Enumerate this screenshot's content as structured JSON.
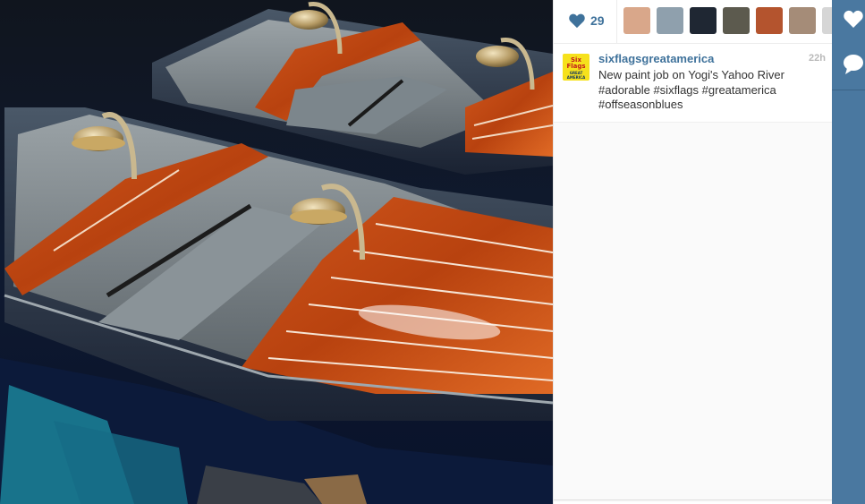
{
  "post": {
    "likes_count": "29",
    "author": {
      "username": "sixflagsgreatamerica",
      "avatar_lines": [
        "Six",
        "Flags"
      ],
      "avatar_sub": "GREAT AMERICA"
    },
    "timestamp": "22h",
    "caption": {
      "text": "New paint job on Yogi's Yahoo River",
      "hashtags": [
        "#adorable",
        "#sixflags",
        "#greatamerica",
        "#offseasonblues"
      ]
    },
    "likers": [
      {
        "color": "#d9a78a"
      },
      {
        "color": "#8fa0ad"
      },
      {
        "color": "#1f2733"
      },
      {
        "color": "#5c5a4e"
      },
      {
        "color": "#b4542e"
      },
      {
        "color": "#a58c78"
      },
      {
        "color": "#d6d6d6"
      }
    ]
  },
  "icons": {
    "like": "heart-icon",
    "rail_like": "heart-icon",
    "rail_comment": "comment-icon"
  },
  "colors": {
    "accent": "#3f729b",
    "rail": "#4a78a0",
    "logo_bg": "#f6e11c"
  }
}
